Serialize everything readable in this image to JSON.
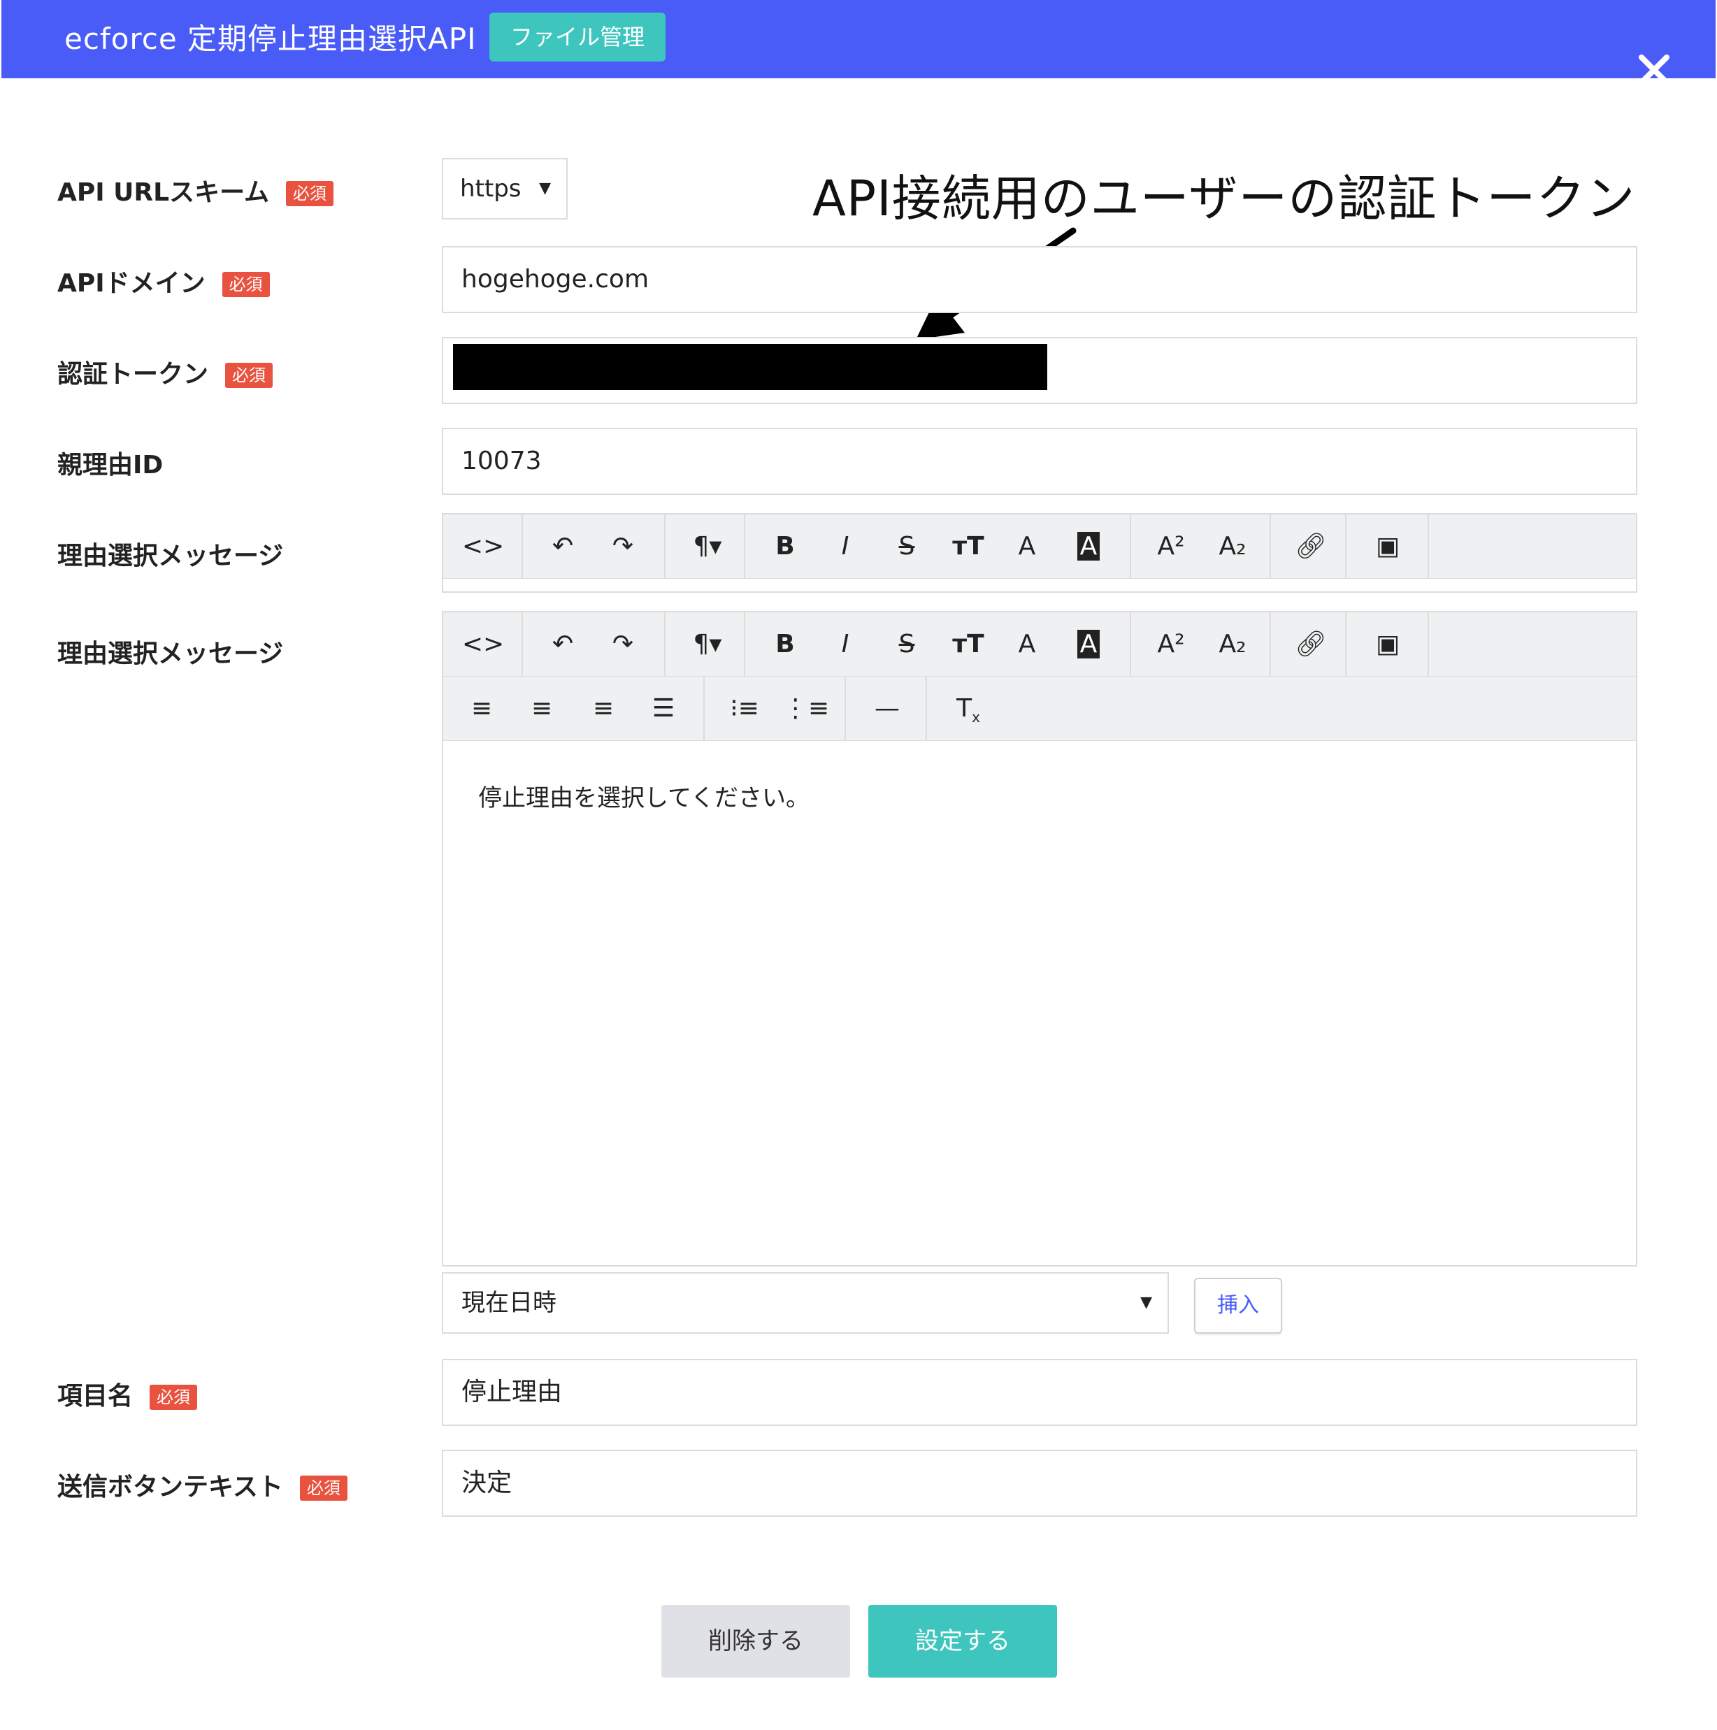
{
  "header": {
    "title": "ecforce 定期停止理由選択API",
    "file_button": "ファイル管理",
    "close_icon": "×",
    "background_color": "#4a5cf8"
  },
  "annotation": {
    "text": "API接続用のユーザーの認証トークン"
  },
  "required_badge": "必須",
  "form": {
    "scheme": {
      "label": "API URLスキーム",
      "value": "https"
    },
    "domain": {
      "label": "APIドメイン",
      "value": "hogehoge.com"
    },
    "token": {
      "label": "認証トークン",
      "value": ""
    },
    "parent_id": {
      "label": "親理由ID",
      "value": "10073"
    },
    "message_1": {
      "label": "理由選択メッセージ"
    },
    "message_2": {
      "label": "理由選択メッセージ",
      "content": "停止理由を選択してください。"
    },
    "insert": {
      "select_value": "現在日時",
      "button_label": "挿入"
    },
    "item_name": {
      "label": "項目名",
      "value": "停止理由"
    },
    "submit_text": {
      "label": "送信ボタンテキスト",
      "value": "決定"
    }
  },
  "toolbar_icons": {
    "row1": [
      "code-view",
      "undo",
      "redo",
      "paragraph",
      "bold",
      "italic",
      "strikethrough",
      "font-size",
      "font-color",
      "background-color",
      "superscript",
      "subscript",
      "link",
      "image"
    ],
    "row2": [
      "align-left",
      "align-center",
      "align-right",
      "align-justify",
      "unordered-list",
      "ordered-list",
      "horizontal-rule",
      "clear-format"
    ]
  },
  "actions": {
    "delete_label": "削除する",
    "submit_label": "設定する",
    "accent_color": "#3ec6be",
    "required_color": "#e8523f"
  }
}
